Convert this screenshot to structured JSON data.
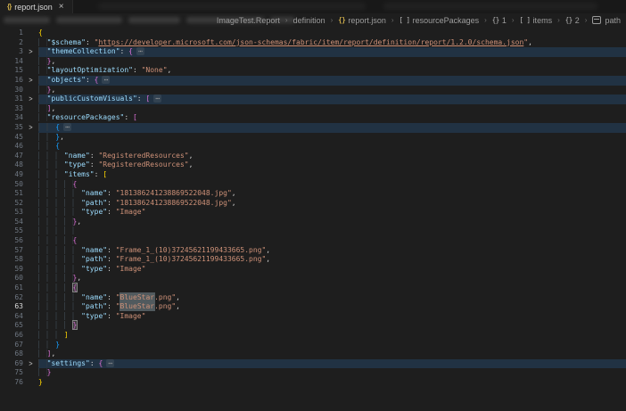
{
  "colors": {
    "editor_bg": "#1e1e1e",
    "tabbar_bg": "#181818",
    "key": "#9cdcfe",
    "string": "#ce9178",
    "bracket_l1": "#ffd700",
    "bracket_l2": "#da70d6",
    "bracket_l3": "#179fff",
    "fold_line_bg": "#264f78",
    "word_highlight": "#515a5e",
    "json_icon": "#cbab4a"
  },
  "icons": {
    "chevron_fold": ">",
    "braces": "{}",
    "brackets": "[ ]",
    "separator": "›"
  },
  "tab_bar": {
    "tab": {
      "icon": "json-braces-icon",
      "icon_glyph": "{}",
      "title": "report.json",
      "close_glyph": "×"
    }
  },
  "breadcrumb_bar": {
    "items": [
      {
        "label": "ImageTest.Report",
        "icon": "none"
      },
      {
        "label": "definition",
        "icon": "none"
      },
      {
        "label": "report.json",
        "icon": "braces-file"
      },
      {
        "label": "resourcePackages",
        "icon": "brackets"
      },
      {
        "label": "1",
        "icon": "braces"
      },
      {
        "label": "items",
        "icon": "brackets"
      },
      {
        "label": "2",
        "icon": "braces"
      },
      {
        "label": "path",
        "icon": "string"
      }
    ]
  },
  "editor": {
    "language": "json",
    "lines": [
      {
        "n": 1,
        "ind": 0,
        "tk": [
          [
            "b1",
            "{"
          ]
        ]
      },
      {
        "n": 2,
        "ind": 2,
        "tk": [
          [
            "key",
            "\"$schema\""
          ],
          [
            "punc",
            ": "
          ],
          [
            "str",
            "\""
          ],
          [
            "link",
            "https://developer.microsoft.com/json-schemas/fabric/item/report/definition/report/1.2.0/schema.json"
          ],
          [
            "str",
            "\""
          ],
          [
            "punc",
            ","
          ]
        ]
      },
      {
        "n": 3,
        "ind": 2,
        "fold": true,
        "tk": [
          [
            "key",
            "\"themeCollection\""
          ],
          [
            "punc",
            ": "
          ],
          [
            "b2",
            "{"
          ],
          [
            "fold",
            "⋯"
          ]
        ]
      },
      {
        "n": 14,
        "ind": 2,
        "tk": [
          [
            "b2",
            "}"
          ],
          [
            "punc",
            ","
          ]
        ]
      },
      {
        "n": 15,
        "ind": 2,
        "tk": [
          [
            "key",
            "\"layoutOptimization\""
          ],
          [
            "punc",
            ": "
          ],
          [
            "str",
            "\"None\""
          ],
          [
            "punc",
            ","
          ]
        ]
      },
      {
        "n": 16,
        "ind": 2,
        "fold": true,
        "tk": [
          [
            "key",
            "\"objects\""
          ],
          [
            "punc",
            ": "
          ],
          [
            "b2",
            "{"
          ],
          [
            "fold",
            "⋯"
          ]
        ]
      },
      {
        "n": 30,
        "ind": 2,
        "tk": [
          [
            "b2",
            "}"
          ],
          [
            "punc",
            ","
          ]
        ]
      },
      {
        "n": 31,
        "ind": 2,
        "fold": true,
        "tk": [
          [
            "key",
            "\"publicCustomVisuals\""
          ],
          [
            "punc",
            ": "
          ],
          [
            "b2",
            "["
          ],
          [
            "fold",
            "⋯"
          ]
        ]
      },
      {
        "n": 33,
        "ind": 2,
        "tk": [
          [
            "b2",
            "]"
          ],
          [
            "punc",
            ","
          ]
        ]
      },
      {
        "n": 34,
        "ind": 2,
        "tk": [
          [
            "key",
            "\"resourcePackages\""
          ],
          [
            "punc",
            ": "
          ],
          [
            "b2",
            "["
          ]
        ]
      },
      {
        "n": 35,
        "ind": 4,
        "fold": true,
        "tk": [
          [
            "b3",
            "{"
          ],
          [
            "fold",
            "⋯"
          ]
        ]
      },
      {
        "n": 45,
        "ind": 4,
        "tk": [
          [
            "b3",
            "}"
          ],
          [
            "punc",
            ","
          ]
        ]
      },
      {
        "n": 46,
        "ind": 4,
        "tk": [
          [
            "b3",
            "{"
          ]
        ]
      },
      {
        "n": 47,
        "ind": 6,
        "tk": [
          [
            "key",
            "\"name\""
          ],
          [
            "punc",
            ": "
          ],
          [
            "str",
            "\"RegisteredResources\""
          ],
          [
            "punc",
            ","
          ]
        ]
      },
      {
        "n": 48,
        "ind": 6,
        "tk": [
          [
            "key",
            "\"type\""
          ],
          [
            "punc",
            ": "
          ],
          [
            "str",
            "\"RegisteredResources\""
          ],
          [
            "punc",
            ","
          ]
        ]
      },
      {
        "n": 49,
        "ind": 6,
        "tk": [
          [
            "key",
            "\"items\""
          ],
          [
            "punc",
            ": "
          ],
          [
            "b1",
            "["
          ]
        ]
      },
      {
        "n": 50,
        "ind": 8,
        "tk": [
          [
            "b2",
            "{"
          ]
        ]
      },
      {
        "n": 51,
        "ind": 10,
        "tk": [
          [
            "key",
            "\"name\""
          ],
          [
            "punc",
            ": "
          ],
          [
            "str",
            "\"181386241238869522048.jpg\""
          ],
          [
            "punc",
            ","
          ]
        ]
      },
      {
        "n": 52,
        "ind": 10,
        "tk": [
          [
            "key",
            "\"path\""
          ],
          [
            "punc",
            ": "
          ],
          [
            "str",
            "\"181386241238869522048.jpg\""
          ],
          [
            "punc",
            ","
          ]
        ]
      },
      {
        "n": 53,
        "ind": 10,
        "tk": [
          [
            "key",
            "\"type\""
          ],
          [
            "punc",
            ": "
          ],
          [
            "str",
            "\"Image\""
          ]
        ]
      },
      {
        "n": 54,
        "ind": 8,
        "tk": [
          [
            "b2",
            "}"
          ],
          [
            "punc",
            ","
          ]
        ]
      },
      {
        "n": 55,
        "ind": 10,
        "tk": []
      },
      {
        "n": 56,
        "ind": 8,
        "tk": [
          [
            "b2",
            "{"
          ]
        ]
      },
      {
        "n": 57,
        "ind": 10,
        "tk": [
          [
            "key",
            "\"name\""
          ],
          [
            "punc",
            ": "
          ],
          [
            "str",
            "\"Frame_1_(10)37245621199433665.png\""
          ],
          [
            "punc",
            ","
          ]
        ]
      },
      {
        "n": 58,
        "ind": 10,
        "tk": [
          [
            "key",
            "\"path\""
          ],
          [
            "punc",
            ": "
          ],
          [
            "str",
            "\"Frame_1_(10)37245621199433665.png\""
          ],
          [
            "punc",
            ","
          ]
        ]
      },
      {
        "n": 59,
        "ind": 10,
        "tk": [
          [
            "key",
            "\"type\""
          ],
          [
            "punc",
            ": "
          ],
          [
            "str",
            "\"Image\""
          ]
        ]
      },
      {
        "n": 60,
        "ind": 8,
        "tk": [
          [
            "b2",
            "}"
          ],
          [
            "punc",
            ","
          ]
        ]
      },
      {
        "n": 61,
        "ind": 8,
        "tk": [
          [
            "b2m",
            "{"
          ]
        ]
      },
      {
        "n": 62,
        "ind": 10,
        "tk": [
          [
            "key",
            "\"name\""
          ],
          [
            "punc",
            ": "
          ],
          [
            "str",
            "\""
          ],
          [
            "strhl",
            "BlueStar"
          ],
          [
            "str",
            ".png\""
          ],
          [
            "punc",
            ","
          ]
        ]
      },
      {
        "n": 63,
        "ind": 10,
        "active": true,
        "tk": [
          [
            "key",
            "\"path\""
          ],
          [
            "punc",
            ": "
          ],
          [
            "str",
            "\""
          ],
          [
            "strhl",
            "BlueStar"
          ],
          [
            "str",
            ".png\""
          ],
          [
            "punc",
            ","
          ]
        ]
      },
      {
        "n": 64,
        "ind": 10,
        "tk": [
          [
            "key",
            "\"type\""
          ],
          [
            "punc",
            ": "
          ],
          [
            "str",
            "\"Image\""
          ]
        ]
      },
      {
        "n": 65,
        "ind": 8,
        "tk": [
          [
            "b2m",
            "}"
          ]
        ]
      },
      {
        "n": 66,
        "ind": 6,
        "tk": [
          [
            "b1",
            "]"
          ]
        ]
      },
      {
        "n": 67,
        "ind": 4,
        "tk": [
          [
            "b3",
            "}"
          ]
        ]
      },
      {
        "n": 68,
        "ind": 2,
        "tk": [
          [
            "b2",
            "]"
          ],
          [
            "punc",
            ","
          ]
        ]
      },
      {
        "n": 69,
        "ind": 2,
        "fold": true,
        "tk": [
          [
            "key",
            "\"settings\""
          ],
          [
            "punc",
            ": "
          ],
          [
            "b2",
            "{"
          ],
          [
            "fold",
            "⋯"
          ]
        ]
      },
      {
        "n": 75,
        "ind": 2,
        "tk": [
          [
            "b2",
            "}"
          ]
        ]
      },
      {
        "n": 76,
        "ind": 0,
        "tk": [
          [
            "b1",
            "}"
          ]
        ]
      }
    ]
  }
}
